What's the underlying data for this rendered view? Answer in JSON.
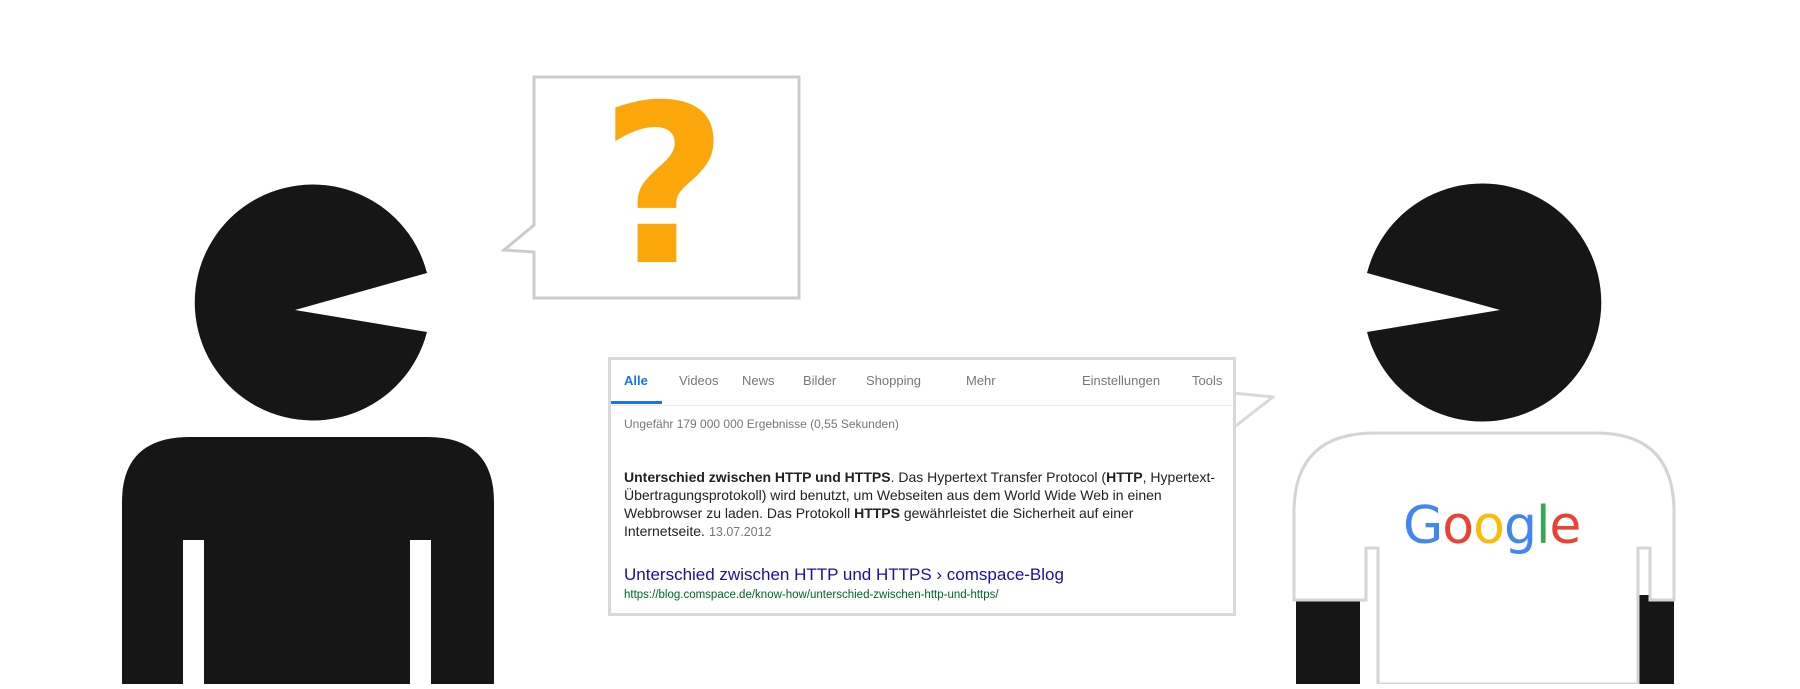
{
  "question": {
    "symbol": "?"
  },
  "search": {
    "tabs": [
      {
        "label": "Alle",
        "active": true
      },
      {
        "label": "Videos"
      },
      {
        "label": "News"
      },
      {
        "label": "Bilder"
      },
      {
        "label": "Shopping"
      },
      {
        "label": "Mehr"
      },
      {
        "label": "Einstellungen"
      },
      {
        "label": "Tools"
      }
    ],
    "result_count": "Ungefähr 179 000 000 Ergebnisse (0,55 Sekunden)",
    "snippet": {
      "title_bold": "Unterschied zwischen HTTP und HTTPS",
      "text_1": ". Das Hypertext Transfer Protocol (",
      "bold_http": "HTTP",
      "text_2": ", Hypertext-Übertragungsprotokoll) wird benutzt, um Webseiten aus dem World Wide Web in einen Webbrowser zu laden. Das Protokoll ",
      "bold_https": "HTTPS",
      "text_3": " gewährleistet die Sicherheit auf einer Internetseite.",
      "date": "13.07.2012"
    },
    "result_title": "Unterschied zwischen HTTP und HTTPS › comspace-Blog",
    "result_url": "https://blog.comspace.de/know-how/unterschied-zwischen-http-und-https/"
  },
  "logo": {
    "letters": [
      "G",
      "o",
      "o",
      "g",
      "l",
      "e"
    ]
  },
  "colors": {
    "figure": "#161616",
    "question_mark": "#FBA70B",
    "bubble_border": "#cccccc",
    "link": "#1a0dab",
    "url": "#006621",
    "active_tab": "#1a73e8"
  }
}
